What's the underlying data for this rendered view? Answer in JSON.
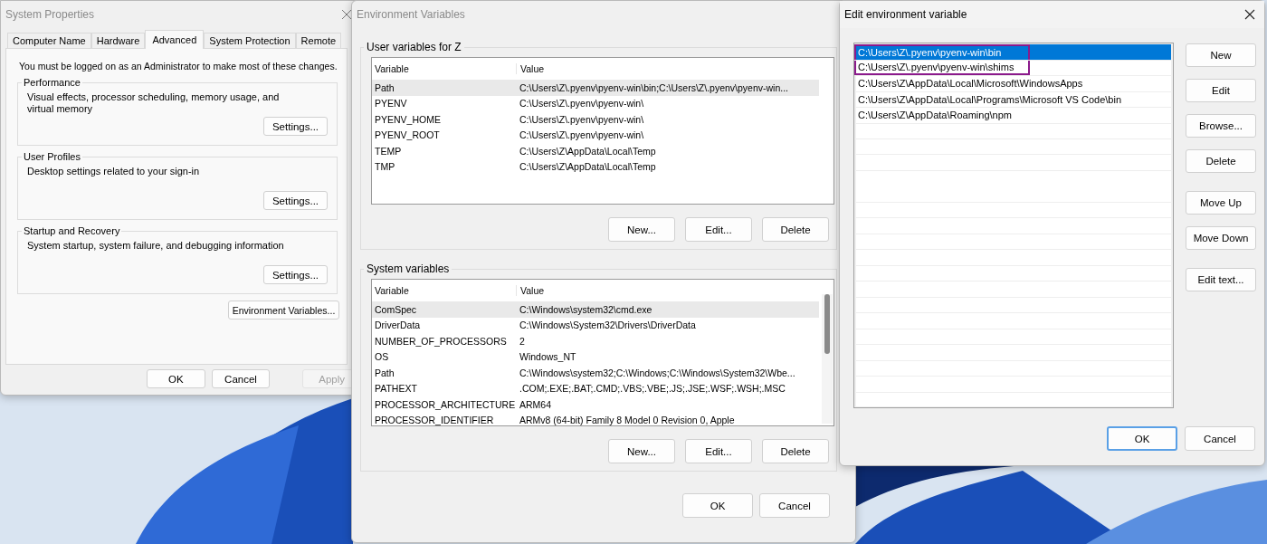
{
  "system_properties": {
    "title": "System Properties",
    "active": false,
    "tabs": [
      {
        "label": "Computer Name",
        "selected": false
      },
      {
        "label": "Hardware",
        "selected": false
      },
      {
        "label": "Advanced",
        "selected": true
      },
      {
        "label": "System Protection",
        "selected": false
      },
      {
        "label": "Remote",
        "selected": false
      }
    ],
    "notice": "You must be logged on as an Administrator to make most of these changes.",
    "groups": [
      {
        "label": "Performance",
        "description": "Visual effects, processor scheduling, memory usage, and virtual memory",
        "button": "Settings..."
      },
      {
        "label": "User Profiles",
        "description": "Desktop settings related to your sign-in",
        "button": "Settings..."
      },
      {
        "label": "Startup and Recovery",
        "description": "System startup, system failure, and debugging information",
        "button": "Settings..."
      }
    ],
    "environment_button": "Environment Variables...",
    "buttons": [
      {
        "label": "OK",
        "disabled": false,
        "default": false
      },
      {
        "label": "Cancel",
        "disabled": false,
        "default": false
      },
      {
        "label": "Apply",
        "disabled": true,
        "default": false
      }
    ]
  },
  "environment_variables": {
    "title": "Environment Variables",
    "active": false,
    "user_variables": {
      "label": "User variables for Z",
      "columns": [
        "Variable",
        "Value"
      ],
      "rows": [
        {
          "variable": "Path",
          "value": "C:\\Users\\Z\\.pyenv\\pyenv-win\\bin;C:\\Users\\Z\\.pyenv\\pyenv-win...",
          "selected": true
        },
        {
          "variable": "PYENV",
          "value": "C:\\Users\\Z\\.pyenv\\pyenv-win\\",
          "selected": false
        },
        {
          "variable": "PYENV_HOME",
          "value": "C:\\Users\\Z\\.pyenv\\pyenv-win\\",
          "selected": false
        },
        {
          "variable": "PYENV_ROOT",
          "value": "C:\\Users\\Z\\.pyenv\\pyenv-win\\",
          "selected": false
        },
        {
          "variable": "TEMP",
          "value": "C:\\Users\\Z\\AppData\\Local\\Temp",
          "selected": false
        },
        {
          "variable": "TMP",
          "value": "C:\\Users\\Z\\AppData\\Local\\Temp",
          "selected": false
        }
      ],
      "buttons": [
        "New...",
        "Edit...",
        "Delete"
      ]
    },
    "system_variables": {
      "label": "System variables",
      "columns": [
        "Variable",
        "Value"
      ],
      "rows": [
        {
          "variable": "ComSpec",
          "value": "C:\\Windows\\system32\\cmd.exe",
          "selected": true
        },
        {
          "variable": "DriverData",
          "value": "C:\\Windows\\System32\\Drivers\\DriverData",
          "selected": false
        },
        {
          "variable": "NUMBER_OF_PROCESSORS",
          "value": "2",
          "selected": false
        },
        {
          "variable": "OS",
          "value": "Windows_NT",
          "selected": false
        },
        {
          "variable": "Path",
          "value": "C:\\Windows\\system32;C:\\Windows;C:\\Windows\\System32\\Wbe...",
          "selected": false
        },
        {
          "variable": "PATHEXT",
          "value": ".COM;.EXE;.BAT;.CMD;.VBS;.VBE;.JS;.JSE;.WSF;.WSH;.MSC",
          "selected": false
        },
        {
          "variable": "PROCESSOR_ARCHITECTURE",
          "value": "ARM64",
          "selected": false
        },
        {
          "variable": "PROCESSOR_IDENTIFIER",
          "value": "ARMv8 (64-bit) Family 8 Model 0 Revision   0, Apple",
          "selected": false
        }
      ],
      "buttons": [
        "New...",
        "Edit...",
        "Delete"
      ]
    },
    "buttons": [
      {
        "label": "OK",
        "disabled": false,
        "default": false
      },
      {
        "label": "Cancel",
        "disabled": false,
        "default": false
      }
    ]
  },
  "edit_variable": {
    "title": "Edit environment variable",
    "active": true,
    "entries": [
      {
        "text": "C:\\Users\\Z\\.pyenv\\pyenv-win\\bin",
        "selected": true,
        "annotated": true
      },
      {
        "text": "C:\\Users\\Z\\.pyenv\\pyenv-win\\shims",
        "selected": false,
        "annotated": true
      },
      {
        "text": "C:\\Users\\Z\\AppData\\Local\\Microsoft\\WindowsApps",
        "selected": false,
        "annotated": false
      },
      {
        "text": "C:\\Users\\Z\\AppData\\Local\\Programs\\Microsoft VS Code\\bin",
        "selected": false,
        "annotated": false
      },
      {
        "text": "C:\\Users\\Z\\AppData\\Roaming\\npm",
        "selected": false,
        "annotated": false
      }
    ],
    "button_groups": [
      [
        "New",
        "Edit",
        "Browse...",
        "Delete"
      ],
      [
        "Move Up",
        "Move Down"
      ],
      [
        "Edit text..."
      ]
    ],
    "buttons": [
      {
        "label": "OK",
        "disabled": false,
        "default": true
      },
      {
        "label": "Cancel",
        "disabled": false,
        "default": false
      }
    ]
  }
}
